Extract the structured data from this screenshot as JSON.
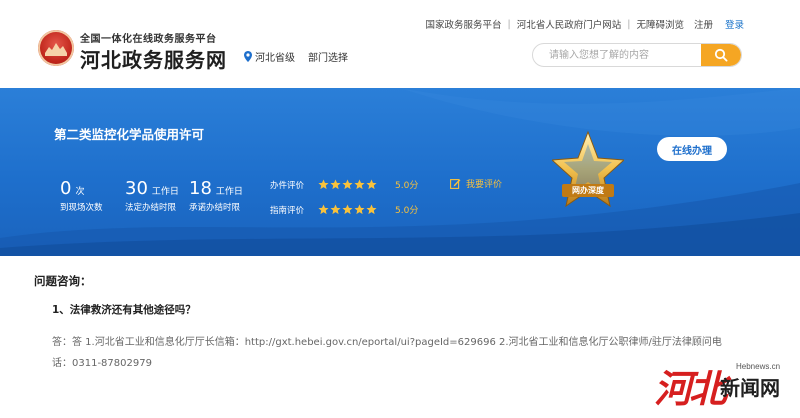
{
  "header": {
    "platform_title": "全国一体化在线政务服务平台",
    "site_name": "河北政务服务网",
    "location": "河北省级",
    "dept_select": "部门选择",
    "links": [
      "国家政务服务平台",
      "河北省人民政府门户网站",
      "无障碍浏览"
    ],
    "register": "注册",
    "login": "登录",
    "search_placeholder": "请输入您想了解的内容"
  },
  "banner": {
    "service_title": "第二类监控化学品使用许可",
    "online_button": "在线办理",
    "badge_label": "网办深度",
    "stats": [
      {
        "num": "0",
        "unit": "次",
        "label": "到现场次数"
      },
      {
        "num": "30",
        "unit": "工作日",
        "label": "法定办结时限"
      },
      {
        "num": "18",
        "unit": "工作日",
        "label": "承诺办结时限"
      }
    ],
    "ratings": [
      {
        "label": "办件评价",
        "stars": 5,
        "score": "5.0分"
      },
      {
        "label": "指南评价",
        "stars": 5,
        "score": "5.0分"
      }
    ],
    "evaluate": "我要评价"
  },
  "content": {
    "section_title": "问题咨询：",
    "question": "1、法律救济还有其他途径吗？",
    "answer_line1": "答：答 1.河北省工业和信息化厅厅长信箱：http://gxt.hebei.gov.cn/eportal/ui?pageId=629696 2.河北省工业和信息化厅公职律师/驻厅法律顾问电",
    "answer_line2": "话：0311-87802979"
  },
  "watermark": {
    "site": "Hebnews.cn",
    "logo_text": "河北",
    "name": "新闻网"
  },
  "colors": {
    "accent_blue": "#1e6fcc",
    "search_orange": "#f5a623",
    "star_gold": "#f9c23c",
    "brand_red": "#c0261b"
  }
}
